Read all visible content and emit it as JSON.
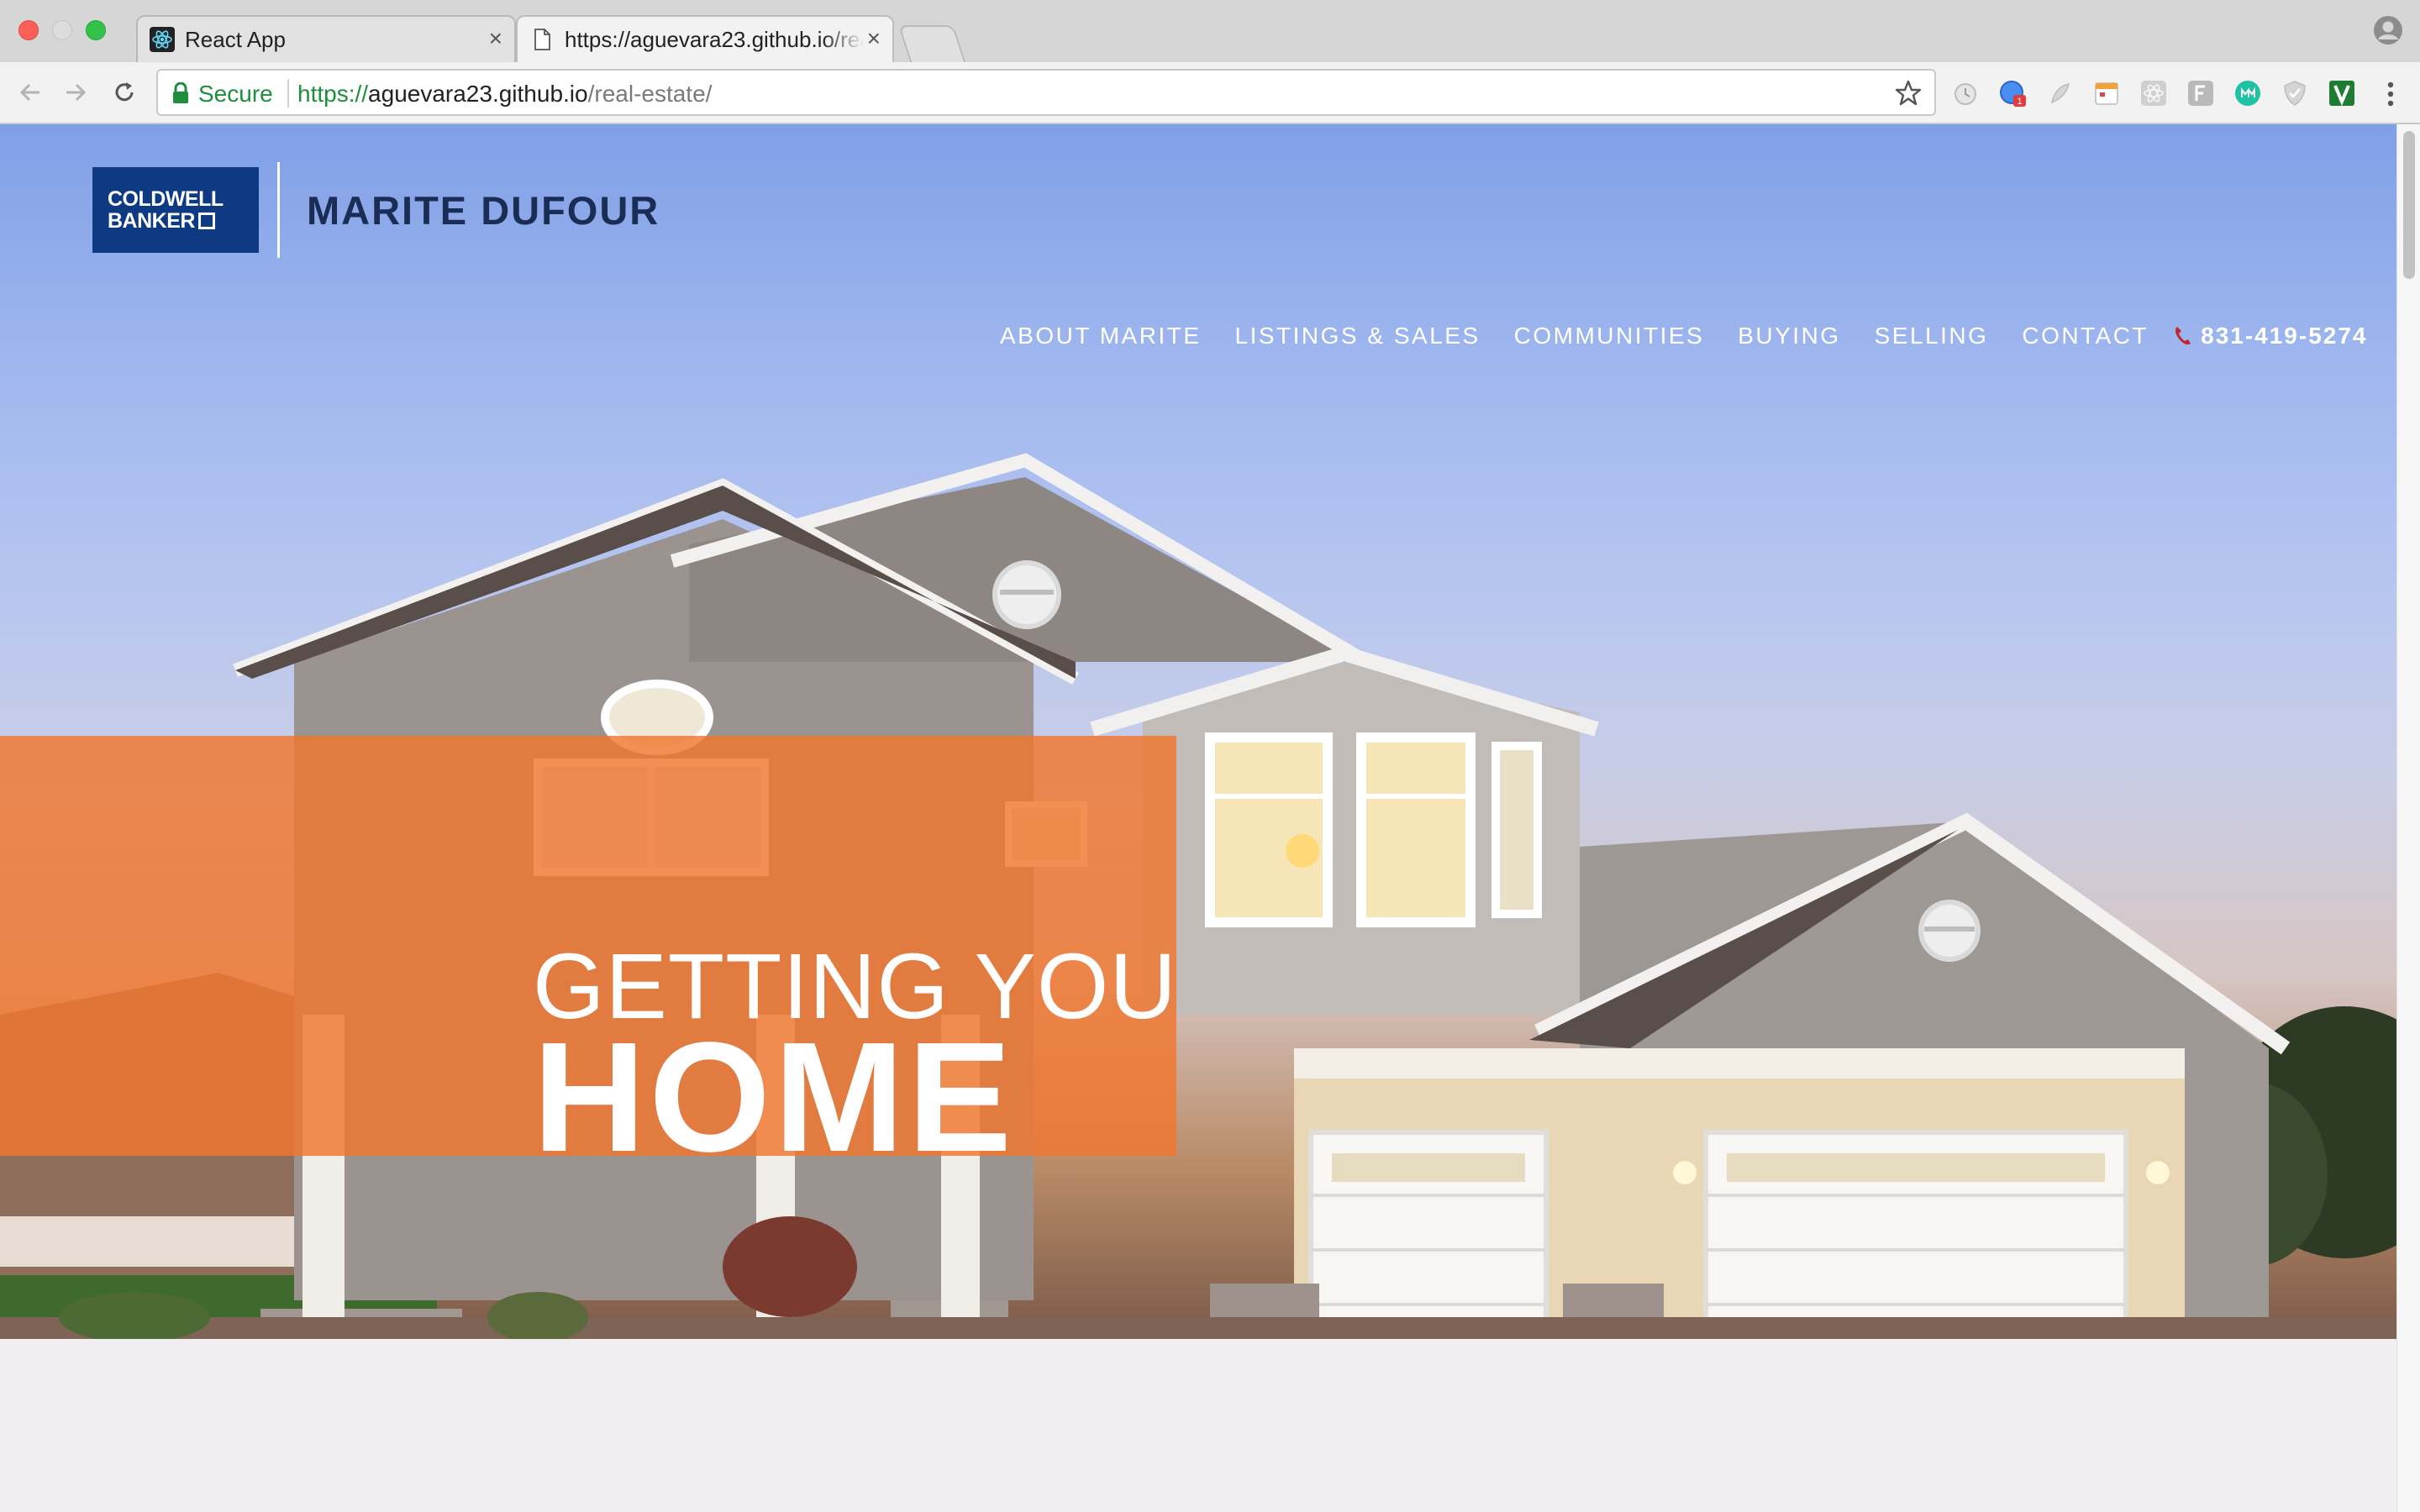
{
  "browser": {
    "tabs": [
      {
        "title": "React App",
        "favicon": "react-icon",
        "active": false
      },
      {
        "title": "https://aguevara23.github.io/real-estate/",
        "favicon": "page-icon",
        "active": true
      }
    ],
    "address_bar": {
      "security_label": "Secure",
      "url_scheme": "https://",
      "url_host": "aguevara23.github.io",
      "url_path": "/real-estate/"
    },
    "extension_icons": [
      "alarm-icon",
      "translate-icon",
      "feather-icon",
      "calendar-icon",
      "react-devtools-icon",
      "font-icon",
      "mercury-icon",
      "shield-icon",
      "vimium-icon"
    ],
    "extension_badge": "1"
  },
  "page": {
    "brand": {
      "logo_line1": "COLDWELL",
      "logo_line2": "BANKER",
      "agent_name": "MARITE DUFOUR"
    },
    "nav": [
      {
        "label": "ABOUT MARITE"
      },
      {
        "label": "LISTINGS & SALES"
      },
      {
        "label": "COMMUNITIES"
      },
      {
        "label": "BUYING"
      },
      {
        "label": "SELLING"
      },
      {
        "label": "CONTACT"
      }
    ],
    "phone": "831-419-5274",
    "hero": {
      "headline_small": "GETTING YOU",
      "headline_large": "HOME"
    }
  },
  "colors": {
    "brand_blue": "#0d3a83",
    "agent_name": "#1a2d55",
    "banner_orange": "#f0762e",
    "phone_icon": "#c0272d",
    "secure_green": "#1e8e3e"
  }
}
